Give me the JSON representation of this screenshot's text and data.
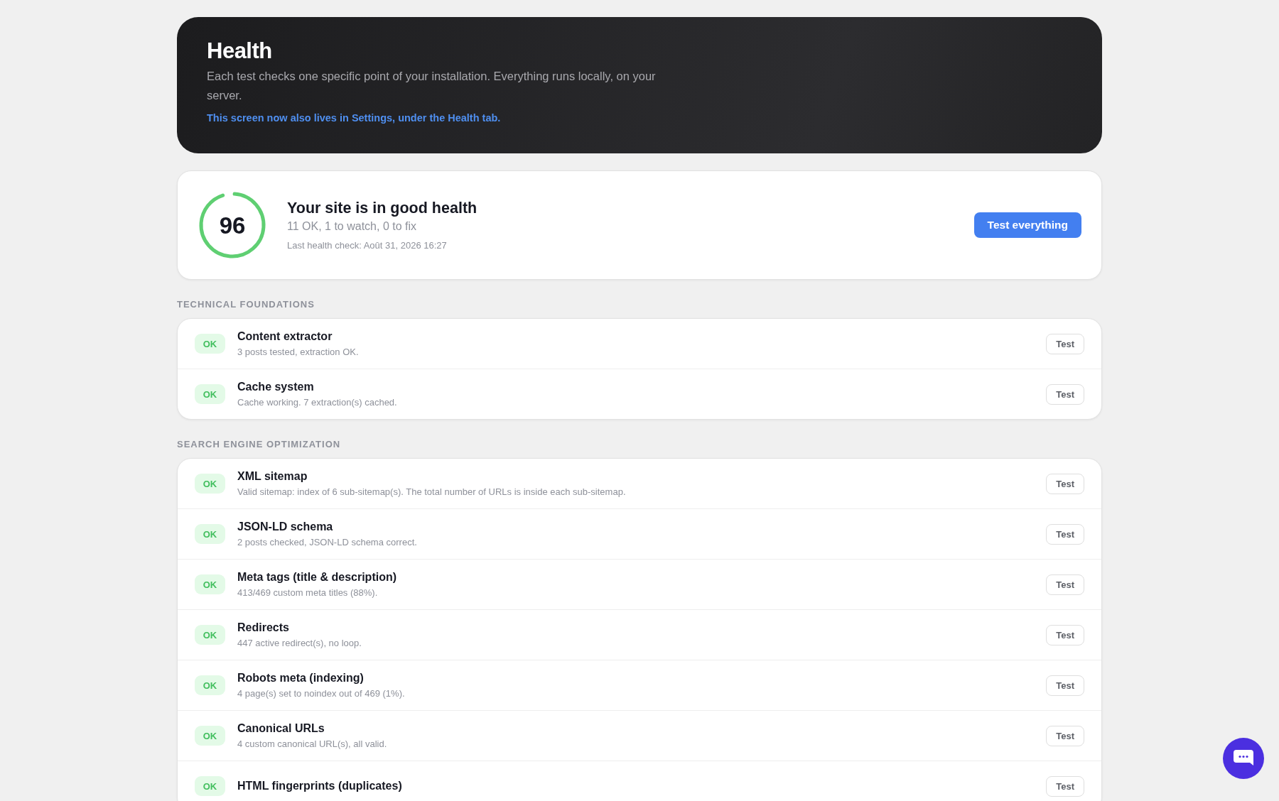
{
  "header": {
    "title": "Health",
    "description": "Each test checks one specific point of your installation. Everything runs locally, on your server.",
    "link": "This screen now also lives in Settings, under the Health tab."
  },
  "summary": {
    "score": "96",
    "level": 0.96,
    "title": "Your site is in good health",
    "counts": "11 OK, 1 to watch, 0 to fix",
    "last_check": "Last health check: Août 31, 2026 16:27",
    "button": "Test everything"
  },
  "sections": [
    {
      "title": "TECHNICAL FOUNDATIONS",
      "tests": [
        {
          "badge": "OK",
          "name": "Content extractor",
          "detail": "3 posts tested, extraction OK.",
          "button": "Test"
        },
        {
          "badge": "OK",
          "name": "Cache system",
          "detail": "Cache working. 7 extraction(s) cached.",
          "button": "Test"
        }
      ]
    },
    {
      "title": "SEARCH ENGINE OPTIMIZATION",
      "tests": [
        {
          "badge": "OK",
          "name": "XML sitemap",
          "detail": "Valid sitemap: index of 6 sub-sitemap(s). The total number of URLs is inside each sub-sitemap.",
          "button": "Test"
        },
        {
          "badge": "OK",
          "name": "JSON-LD schema",
          "detail": "2 posts checked, JSON-LD schema correct.",
          "button": "Test"
        },
        {
          "badge": "OK",
          "name": "Meta tags (title & description)",
          "detail": "413/469 custom meta titles (88%).",
          "button": "Test"
        },
        {
          "badge": "OK",
          "name": "Redirects",
          "detail": "447 active redirect(s), no loop.",
          "button": "Test"
        },
        {
          "badge": "OK",
          "name": "Robots meta (indexing)",
          "detail": "4 page(s) set to noindex out of 469 (1%).",
          "button": "Test"
        },
        {
          "badge": "OK",
          "name": "Canonical URLs",
          "detail": "4 custom canonical URL(s), all valid.",
          "button": "Test"
        },
        {
          "badge": "OK",
          "name": "HTML fingerprints (duplicates)",
          "button": "Test"
        }
      ]
    }
  ]
}
